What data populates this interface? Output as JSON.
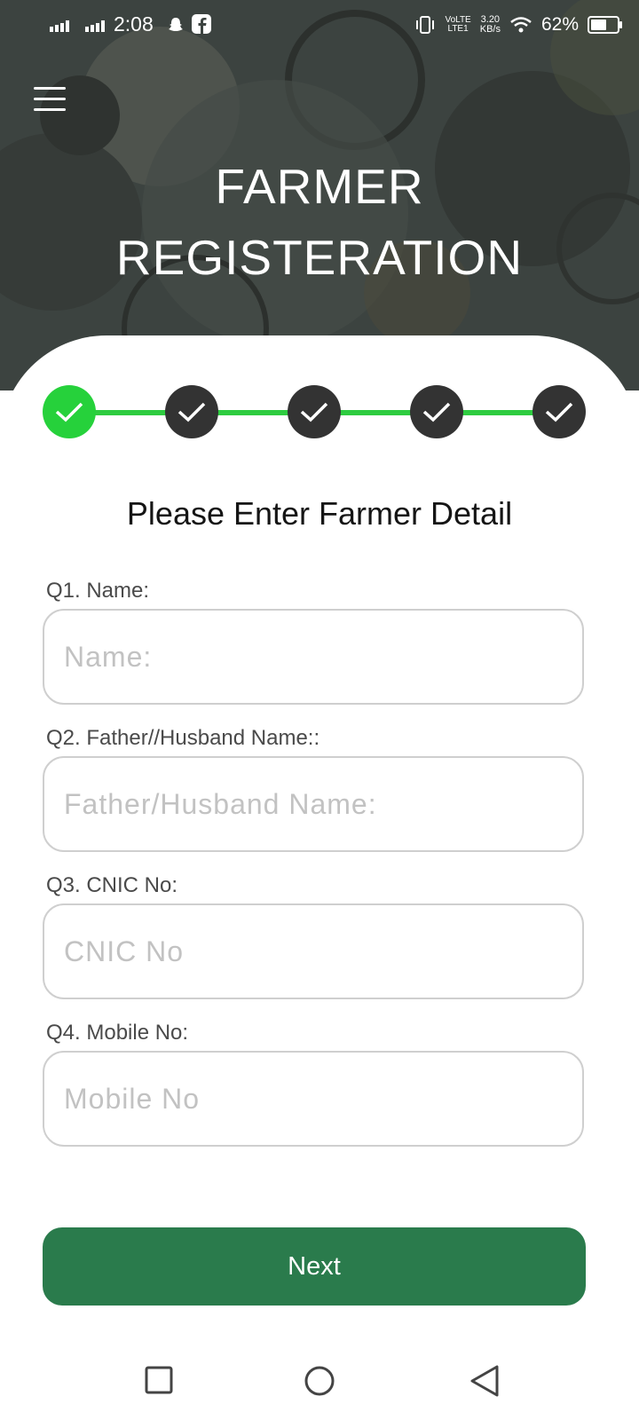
{
  "status_bar": {
    "time": "2:08",
    "network_type": "LTE1",
    "net_speed": "3.20",
    "net_speed_unit": "KB/s",
    "battery_percent": "62%",
    "battery_level": 0.62
  },
  "header": {
    "title_line1": "FARMER",
    "title_line2": "REGISTERATION"
  },
  "stepper": {
    "steps": [
      {
        "state": "completed-active",
        "color": "#26d13b"
      },
      {
        "state": "completed",
        "color": "#333333"
      },
      {
        "state": "completed",
        "color": "#333333"
      },
      {
        "state": "completed",
        "color": "#333333"
      },
      {
        "state": "completed",
        "color": "#333333"
      }
    ],
    "line_color": "#2ecc40"
  },
  "form": {
    "heading": "Please Enter Farmer Detail",
    "q1_label": "Q1. Name:",
    "q1_placeholder": "Name:",
    "q2_label": "Q2. Father//Husband Name::",
    "q2_placeholder": "Father/Husband Name:",
    "q3_label": "Q3. CNIC No:",
    "q3_placeholder": "CNIC No",
    "q4_label": "Q4. Mobile No:",
    "q4_placeholder": "Mobile No",
    "next_label": "Next"
  },
  "colors": {
    "header_bg": "#3c4340",
    "primary_button": "#2a7b4c",
    "active_step": "#26d13b"
  },
  "icons": {
    "menu": "hamburger-icon",
    "check": "checkmark-icon",
    "nav_recent": "square-icon",
    "nav_home": "circle-icon",
    "nav_back": "triangle-back-icon"
  }
}
